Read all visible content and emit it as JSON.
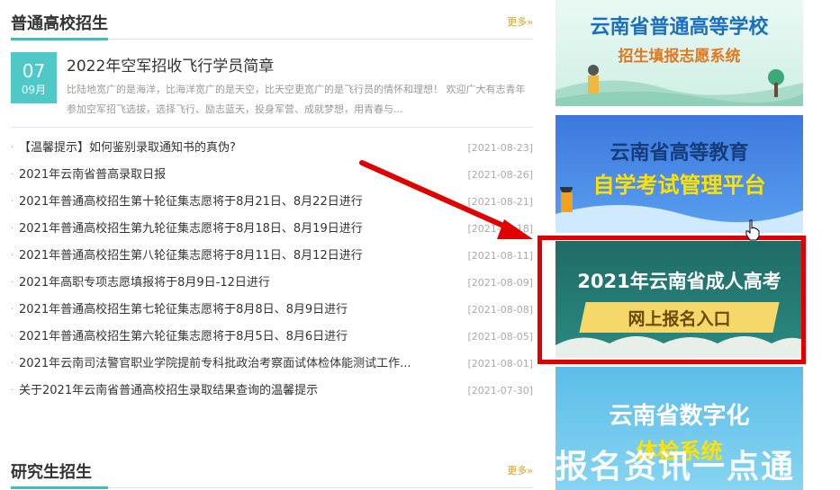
{
  "undergrad_section": {
    "title": "普通高校招生",
    "more_label": "更多»"
  },
  "featured": {
    "day": "07",
    "month": "09月",
    "title": "2022年空军招收飞行学员简章",
    "desc": "比陆地宽广的是海洋，比海洋宽广的是天空，比天空更宽广的是飞行员的情怀和理想！ 欢迎广大有志青年参加空军招飞选拔，选择飞行、励志蓝天，投身军营、成就梦想，用青春与..."
  },
  "news": [
    {
      "title": "【温馨提示】如何鉴别录取通知书的真伪?",
      "date": "[2021-08-23]"
    },
    {
      "title": "2021年云南省普高录取日报",
      "date": "[2021-08-26]"
    },
    {
      "title": "2021年普通高校招生第十轮征集志愿将于8月21日、8月22日进行",
      "date": "[2021-08-21]"
    },
    {
      "title": "2021年普通高校招生第九轮征集志愿将于8月18日、8月19日进行",
      "date": "[2021-08-18]"
    },
    {
      "title": "2021年普通高校招生第八轮征集志愿将于8月11日、8月12日进行",
      "date": "[2021-08-11]"
    },
    {
      "title": "2021年高职专项志愿填报将于8月9日-12日进行",
      "date": "[2021-08-09]"
    },
    {
      "title": "2021年普通高校招生第七轮征集志愿将于8月8日、8月9日进行",
      "date": "[2021-08-08]"
    },
    {
      "title": "2021年普通高校招生第六轮征集志愿将于8月5日、8月6日进行",
      "date": "[2021-08-05]"
    },
    {
      "title": "2021年云南司法警官职业学院提前专科批政治考察面试体检体能测试工作...",
      "date": "[2021-08-01]"
    },
    {
      "title": "关于2021年云南省普通高校招生录取结果查询的温馨提示",
      "date": "[2021-07-30]"
    }
  ],
  "grad_section": {
    "title": "研究生招生",
    "more_label": "更多»"
  },
  "banners": {
    "b1_line1": "云南省普通高等学校",
    "b1_line2": "招生填报志愿系统",
    "b2_line1": "云南省高等教育",
    "b2_line2": "自学考试管理平台",
    "b3_line1": "2021年云南省成人高考",
    "b3_line2": "网上报名入口",
    "b4_line1": "云南省数字化",
    "b4_line2": "体检系统"
  },
  "watermark": "报名资讯一点通",
  "colors": {
    "accent": "#3bbfc1",
    "more_link": "#e0a020",
    "highlight": "#e00000"
  },
  "icons": {
    "cursor": "hand-pointer-icon",
    "arrow": "red-arrow-annotation"
  }
}
